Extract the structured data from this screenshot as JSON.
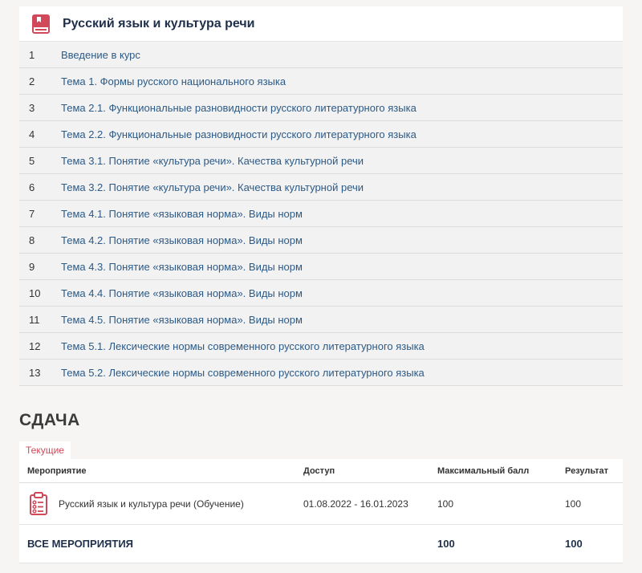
{
  "course": {
    "title": "Русский язык и культура речи",
    "icon": "book-icon",
    "accent_color": "#d0485a",
    "topics": [
      {
        "num": "1",
        "title": "Введение в курс"
      },
      {
        "num": "2",
        "title": "Тема 1. Формы русского национального языка"
      },
      {
        "num": "3",
        "title": "Тема 2.1. Функциональные разновидности русского литературного языка"
      },
      {
        "num": "4",
        "title": "Тема 2.2. Функциональные разновидности русского литературного языка"
      },
      {
        "num": "5",
        "title": "Тема 3.1. Понятие «культура речи». Качества культурной речи"
      },
      {
        "num": "6",
        "title": "Тема 3.2. Понятие «культура речи». Качества культурной речи"
      },
      {
        "num": "7",
        "title": "Тема 4.1. Понятие «языковая норма». Виды норм"
      },
      {
        "num": "8",
        "title": "Тема 4.2. Понятие «языковая норма». Виды норм"
      },
      {
        "num": "9",
        "title": "Тема 4.3. Понятие «языковая норма». Виды норм"
      },
      {
        "num": "10",
        "title": "Тема 4.4. Понятие «языковая норма». Виды норм"
      },
      {
        "num": "11",
        "title": "Тема 4.5. Понятие «языковая норма». Виды норм"
      },
      {
        "num": "12",
        "title": "Тема 5.1. Лексические нормы современного русского литературного языка"
      },
      {
        "num": "13",
        "title": "Тема 5.2. Лексические нормы современного русского литературного языка"
      }
    ]
  },
  "submission": {
    "title": "СДАЧА",
    "tab_current": "Текущие",
    "columns": {
      "event": "Мероприятие",
      "access": "Доступ",
      "max_score": "Максимальный балл",
      "result": "Результат"
    },
    "rows": [
      {
        "icon": "clipboard-checklist-icon",
        "event": "Русский язык и культура речи (Обучение)",
        "access": "01.08.2022 - 16.01.2023",
        "max_score": "100",
        "result": "100"
      }
    ],
    "total": {
      "label": "ВСЕ МЕРОПРИЯТИЯ",
      "max_score": "100",
      "result": "100"
    }
  }
}
